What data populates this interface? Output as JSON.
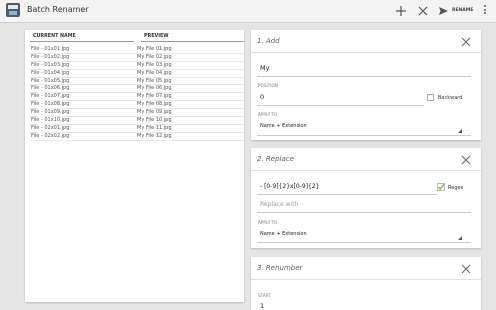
{
  "app": {
    "title": "Batch Renamer"
  },
  "toolbar": {
    "rename_label": "RENAME"
  },
  "icons": {
    "app": "batch-renamer-icon",
    "add": "plus-icon",
    "clear": "close-icon",
    "rename": "send-icon",
    "overflow": "more-vert-icon"
  },
  "file_table": {
    "columns": [
      "CURRENT NAME",
      "PREVIEW"
    ],
    "rows": [
      [
        "File - 01x01.jpg",
        "My File 01.jpg"
      ],
      [
        "File - 01x02.jpg",
        "My File 02.jpg"
      ],
      [
        "File - 01x03.jpg",
        "My File 03.jpg"
      ],
      [
        "File - 01x04.jpg",
        "My File 04.jpg"
      ],
      [
        "File - 01x05.jpg",
        "My File 05.jpg"
      ],
      [
        "File - 01x06.jpg",
        "My File 06.jpg"
      ],
      [
        "File - 01x07.jpg",
        "My File 07.jpg"
      ],
      [
        "File - 01x08.jpg",
        "My File 08.jpg"
      ],
      [
        "File - 01x09.jpg",
        "My File 09.jpg"
      ],
      [
        "File - 01x10.jpg",
        "My File 10.jpg"
      ],
      [
        "File - 02x01.jpg",
        "My File 11.jpg"
      ],
      [
        "File - 02x02.jpg",
        "My File 12.jpg"
      ]
    ]
  },
  "actions": {
    "add": {
      "title": "1. Add",
      "text_value": "My",
      "position_label": "POSITION",
      "position_value": "0",
      "backward_label": "Backward",
      "backward_checked": false,
      "apply_to_label": "APPLY TO",
      "apply_to_value": "Name + Extension"
    },
    "replace": {
      "title": "2. Replace",
      "find_value": "- [0-9]{2}x[0-9]{2}",
      "regex_label": "Regex",
      "regex_checked": true,
      "replace_placeholder": "Replace with",
      "apply_to_label": "APPLY TO",
      "apply_to_value": "Name + Extension"
    },
    "renumber": {
      "title": "3. Renumber",
      "start_label": "START",
      "start_value": "1"
    }
  },
  "colors": {
    "background": "#e5e5e5",
    "actionbar": "#f3f3f3",
    "card": "#ffffff",
    "regex_check": "#8bc34a"
  }
}
